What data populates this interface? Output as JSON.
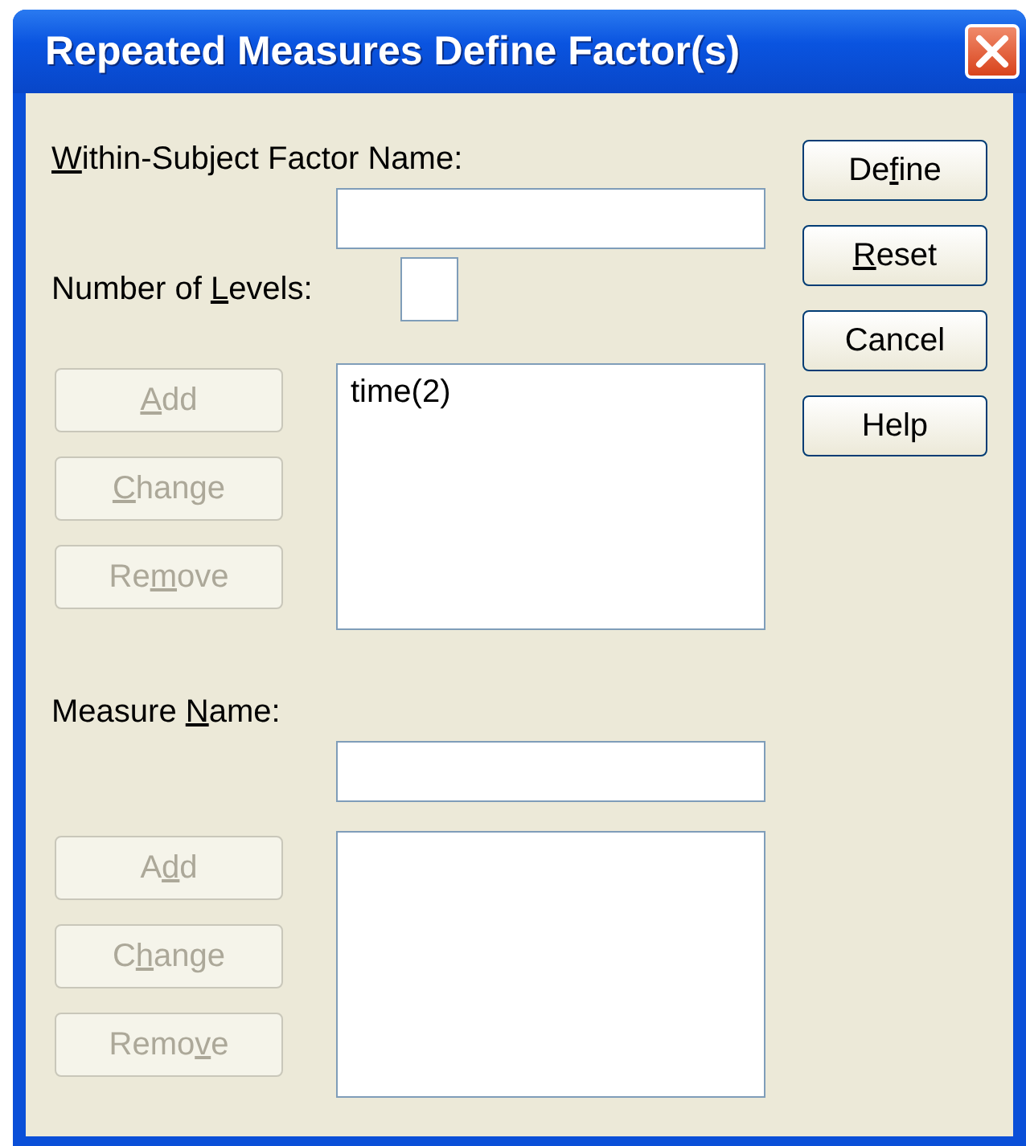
{
  "window": {
    "title": "Repeated Measures Define Factor(s)"
  },
  "factor": {
    "name_label": {
      "key": "W",
      "after": "ithin-Subject Factor Name:"
    },
    "levels_label": {
      "before": "Number of ",
      "key": "L",
      "after": "evels:"
    },
    "buttons": [
      {
        "label": {
          "key": "A",
          "after": "dd"
        },
        "disabled": true
      },
      {
        "label": {
          "key": "C",
          "after": "hange"
        },
        "disabled": true
      },
      {
        "label": {
          "before": "Re",
          "key": "m",
          "after": "ove"
        },
        "disabled": true
      }
    ],
    "list": [
      "time(2)"
    ]
  },
  "measure": {
    "name_label": {
      "before": "Measure ",
      "key": "N",
      "after": "ame:"
    },
    "buttons": [
      {
        "label": {
          "before": "A",
          "key": "d",
          "after": "d"
        },
        "disabled": true
      },
      {
        "label": {
          "before": "C",
          "key": "h",
          "after": "ange"
        },
        "disabled": true
      },
      {
        "label": {
          "before": "Remo",
          "key": "v",
          "after": "e"
        },
        "disabled": true
      }
    ]
  },
  "actions": [
    {
      "label": {
        "before": "De",
        "key": "f",
        "after": "ine"
      },
      "disabled": false
    },
    {
      "label": {
        "key": "R",
        "after": "eset"
      },
      "disabled": false
    },
    {
      "label": {
        "before": "Cancel"
      },
      "disabled": false
    },
    {
      "label": {
        "before": "Help"
      },
      "disabled": false
    }
  ]
}
